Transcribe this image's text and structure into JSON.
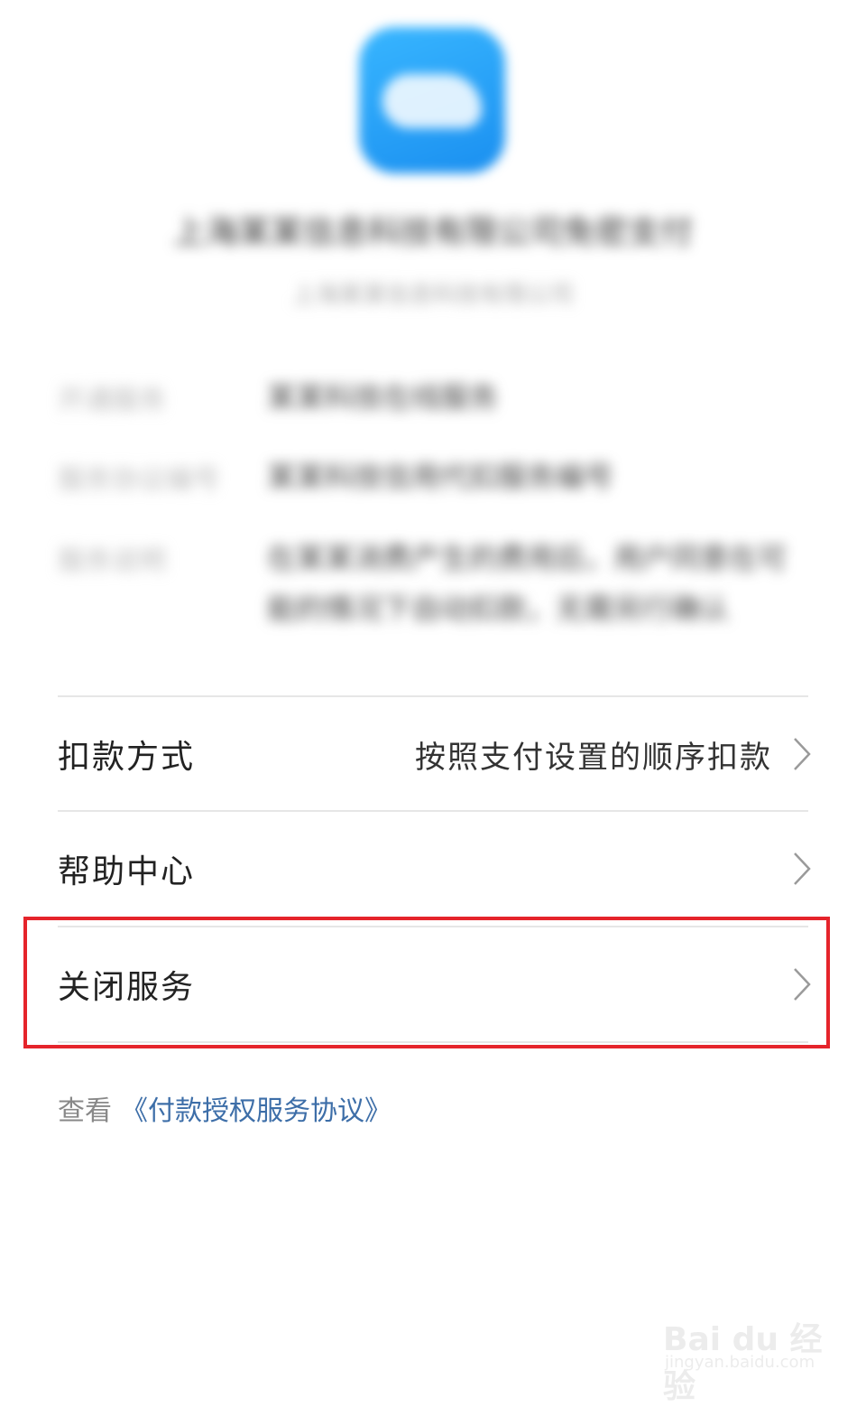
{
  "header": {
    "app_icon": "cloud-icon",
    "merchant_name": "上海某某信息科技有限公司免密支付",
    "merchant_sub": "上海某某信息科技有限公司"
  },
  "info_rows": [
    {
      "label": "开通服务",
      "value": "某某科技在线服务"
    },
    {
      "label": "服务协议编号",
      "value": "某某科技信用代扣服务编号"
    },
    {
      "label": "服务说明",
      "value": "在某某消费产生的费用后，用户同意在可能的情况下自动扣款，无需另行确认"
    }
  ],
  "menu": {
    "deduction_method": {
      "label": "扣款方式",
      "value": "按照支付设置的顺序扣款"
    },
    "help_center": {
      "label": "帮助中心"
    },
    "close_service": {
      "label": "关闭服务"
    }
  },
  "agreement": {
    "prefix": "查看",
    "link": "《付款授权服务协议》"
  },
  "highlight_color": "#e5242b",
  "link_color": "#3d6ea8",
  "watermark": {
    "brand": "Bai du 经验",
    "sub": "jingyan.baidu.com"
  }
}
